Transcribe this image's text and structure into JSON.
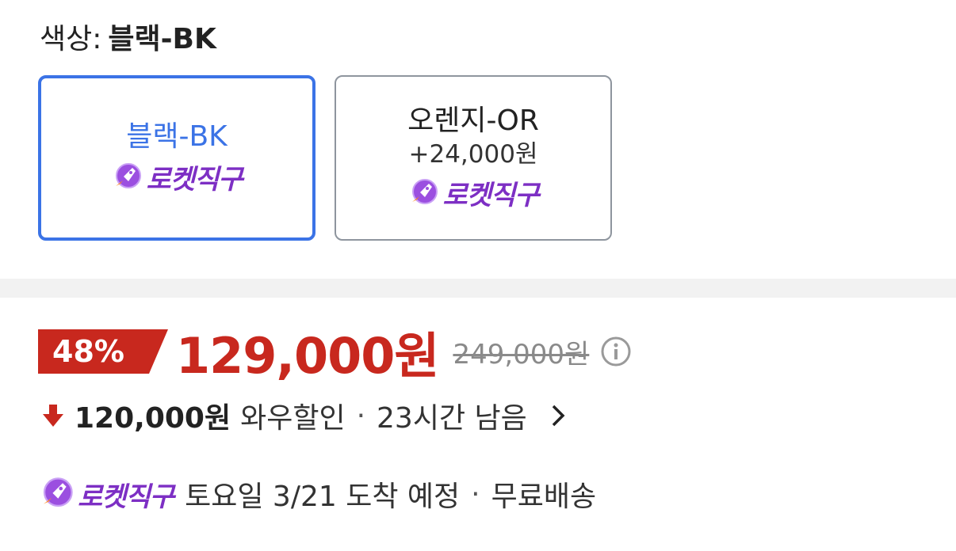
{
  "color_option": {
    "label": "색상:",
    "selected": "블랙-BK"
  },
  "options": [
    {
      "name": "블랙-BK",
      "extra": "",
      "badge": "로켓직구",
      "selected": true
    },
    {
      "name": "오렌지-OR",
      "extra": "+24,000원",
      "badge": "로켓직구",
      "selected": false
    }
  ],
  "price": {
    "discount": "48%",
    "sale": "129,000원",
    "original": "249,000원"
  },
  "wow": {
    "amount": "120,000원",
    "label": "와우할인",
    "separator": "·",
    "remaining": "23시간 남음"
  },
  "shipping": {
    "badge": "로켓직구",
    "text": "토요일 3/21 도착 예정",
    "separator": "·",
    "free": "무료배송"
  },
  "colors": {
    "accent_blue": "#3b73e6",
    "price_red": "#c8281e",
    "rocket_purple": "#7d2fc4"
  },
  "icons": [
    "rocket-icon",
    "info-icon",
    "down-arrow-icon",
    "chevron-right-icon"
  ]
}
